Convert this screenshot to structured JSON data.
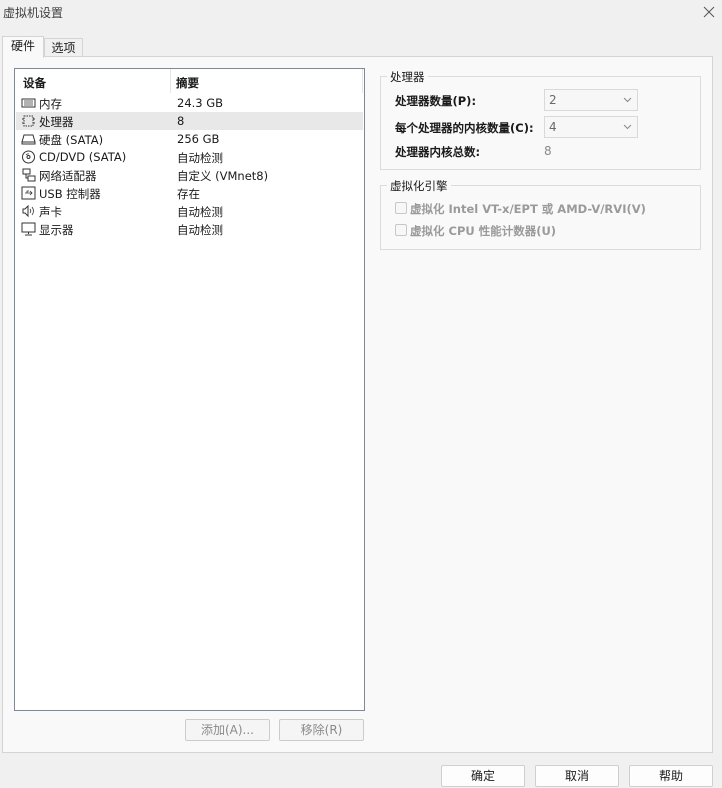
{
  "window": {
    "title": "虚拟机设置"
  },
  "tabs": [
    {
      "label": "硬件"
    },
    {
      "label": "选项"
    }
  ],
  "device_list": {
    "columns": {
      "device": "设备",
      "summary": "摘要"
    },
    "rows": [
      {
        "device": "内存",
        "summary": "24.3 GB",
        "icon": "memory-icon"
      },
      {
        "device": "处理器",
        "summary": "8",
        "icon": "processor-icon",
        "selected": true
      },
      {
        "device": "硬盘 (SATA)",
        "summary": "256 GB",
        "icon": "hard-disk-icon"
      },
      {
        "device": "CD/DVD (SATA)",
        "summary": "自动检测",
        "icon": "cd-dvd-icon"
      },
      {
        "device": "网络适配器",
        "summary": "自定义 (VMnet8)",
        "icon": "network-adapter-icon"
      },
      {
        "device": "USB 控制器",
        "summary": "存在",
        "icon": "usb-icon"
      },
      {
        "device": "声卡",
        "summary": "自动检测",
        "icon": "sound-card-icon"
      },
      {
        "device": "显示器",
        "summary": "自动检测",
        "icon": "display-icon"
      }
    ]
  },
  "list_buttons": {
    "add": "添加(A)...",
    "remove": "移除(R)"
  },
  "processors": {
    "title": "处理器",
    "count_label": "处理器数量(P):",
    "count_value": "2",
    "cores_label": "每个处理器的内核数量(C):",
    "cores_value": "4",
    "total_label": "处理器内核总数:",
    "total_value": "8"
  },
  "virtualization": {
    "title": "虚拟化引擎",
    "option1": "虚拟化 Intel VT-x/EPT 或 AMD-V/RVI(V)",
    "option2": "虚拟化 CPU 性能计数器(U)"
  },
  "footer": {
    "ok": "确定",
    "cancel": "取消",
    "help": "帮助"
  }
}
